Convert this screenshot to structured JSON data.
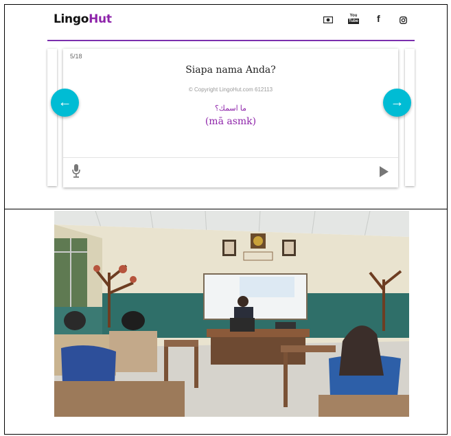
{
  "app": {
    "logo_part1": "Lingo",
    "logo_part2": "Hut",
    "social_icons": [
      "money-icon",
      "youtube-icon",
      "facebook-icon",
      "instagram-icon"
    ],
    "social_glyphs": {
      "youtube_top": "You",
      "youtube_bottom": "Tube",
      "facebook": "f"
    },
    "brand_color": "#8e24aa",
    "accent_color": "#00bcd4"
  },
  "card": {
    "counter": "5/18",
    "phrase": "Siapa nama Anda?",
    "copyright": "© Copyright LingoHut.com 612113",
    "arabic": "ما اسمك؟",
    "transliteration": "(mā asmk)"
  },
  "nav": {
    "prev_glyph": "←",
    "next_glyph": "→"
  }
}
